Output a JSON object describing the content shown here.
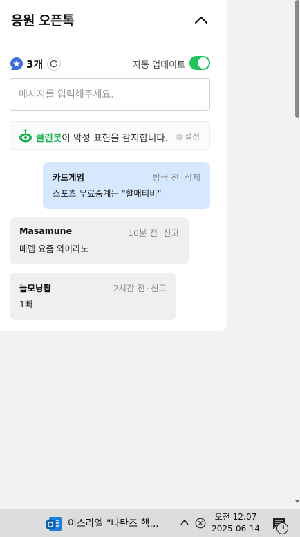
{
  "header": {
    "title": "응원 오픈톡"
  },
  "meta": {
    "count": "3개",
    "auto_update_label": "자동 업데이트",
    "auto_update_on": true
  },
  "input": {
    "placeholder": "메시지를 입력해주세요."
  },
  "cleanbot": {
    "name": "클린봇",
    "message": "이 악성 표현을 감지합니다.",
    "settings_label": "설정"
  },
  "messages": [
    {
      "author": "카드게임",
      "time": "방금 전",
      "action": "삭제",
      "text": "스포츠 무료중계는 \"할매티비\"",
      "mine": true
    },
    {
      "author": "Masamune",
      "time": "10분 전",
      "action": "신고",
      "text": "메뎁 요즘 와이라노",
      "mine": false
    },
    {
      "author": "늘모닝팝",
      "time": "2시간 전",
      "action": "신고",
      "text": "1빠",
      "mine": false
    }
  ],
  "taskbar": {
    "news_text": "이스라엘 \"나탄즈 핵...",
    "clock_ampm_time": "오전 12:07",
    "clock_date": "2025-06-14",
    "notification_count": "3"
  },
  "colors": {
    "accent_green": "#1fc35a",
    "my_bubble": "#d6e8fd",
    "other_bubble": "#efefef"
  },
  "icons": [
    "chevron-up-icon",
    "star-badge-icon",
    "refresh-icon",
    "cleanbot-icon",
    "gear-icon",
    "news-icon",
    "tray-chevron-icon",
    "close-circle-icon",
    "notification-icon"
  ]
}
